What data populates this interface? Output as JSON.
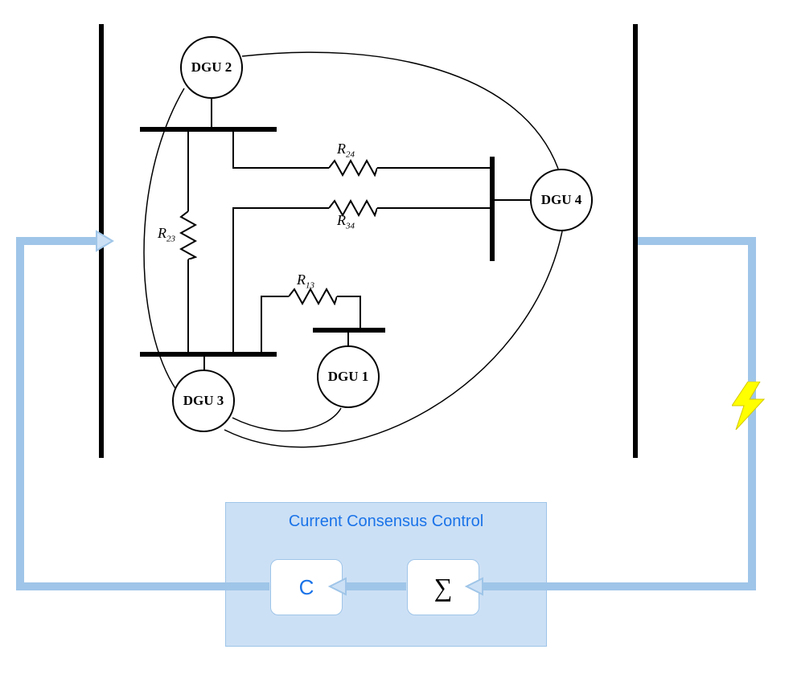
{
  "nodes": {
    "dgu1": "DGU 1",
    "dgu2": "DGU 2",
    "dgu3": "DGU 3",
    "dgu4": "DGU 4"
  },
  "resistors": {
    "r13": "R",
    "r13_sub": "13",
    "r23": "R",
    "r23_sub": "23",
    "r24": "R",
    "r24_sub": "24",
    "r34": "R",
    "r34_sub": "34"
  },
  "control": {
    "title": "Current Consensus Control",
    "c_block": "C",
    "sum_block": "∑"
  }
}
